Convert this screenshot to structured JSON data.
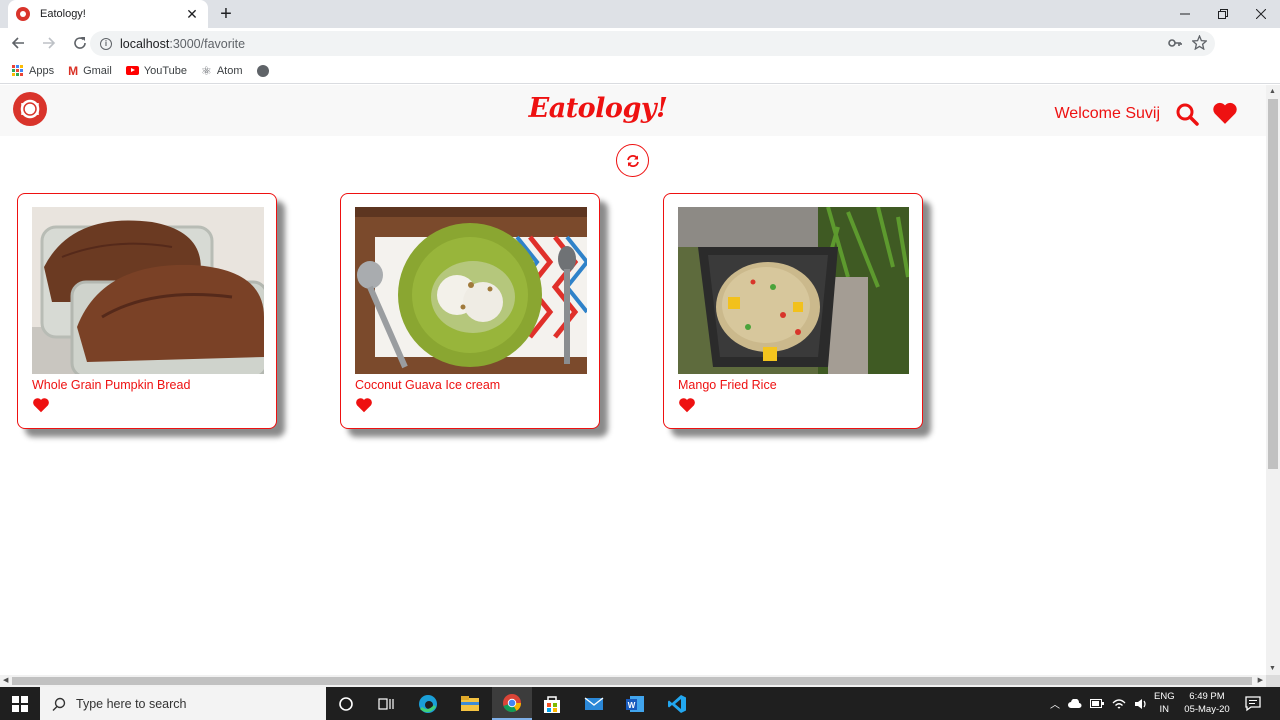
{
  "browser": {
    "tab_title": "Eatology!",
    "url_host": "localhost",
    "url_path": ":3000/favorite",
    "new_tab_symbol": "+",
    "close_tab_symbol": "✕"
  },
  "bookmarks": [
    {
      "label": "Apps",
      "icon": "apps-grid-icon"
    },
    {
      "label": "Gmail",
      "icon": "gmail-icon"
    },
    {
      "label": "YouTube",
      "icon": "youtube-icon"
    },
    {
      "label": "Atom",
      "icon": "atom-icon"
    }
  ],
  "app": {
    "brand": "Eatology!",
    "welcome": "Welcome Suvij",
    "accent_color": "#e11111"
  },
  "favorites": [
    {
      "title": "Whole Grain Pumpkin Bread"
    },
    {
      "title": "Coconut Guava Ice cream"
    },
    {
      "title": "Mango Fried Rice"
    }
  ],
  "taskbar": {
    "search_placeholder": "Type here to search",
    "lang_line1": "ENG",
    "lang_line2": "IN",
    "time": "6:49 PM",
    "date": "05-May-20"
  }
}
